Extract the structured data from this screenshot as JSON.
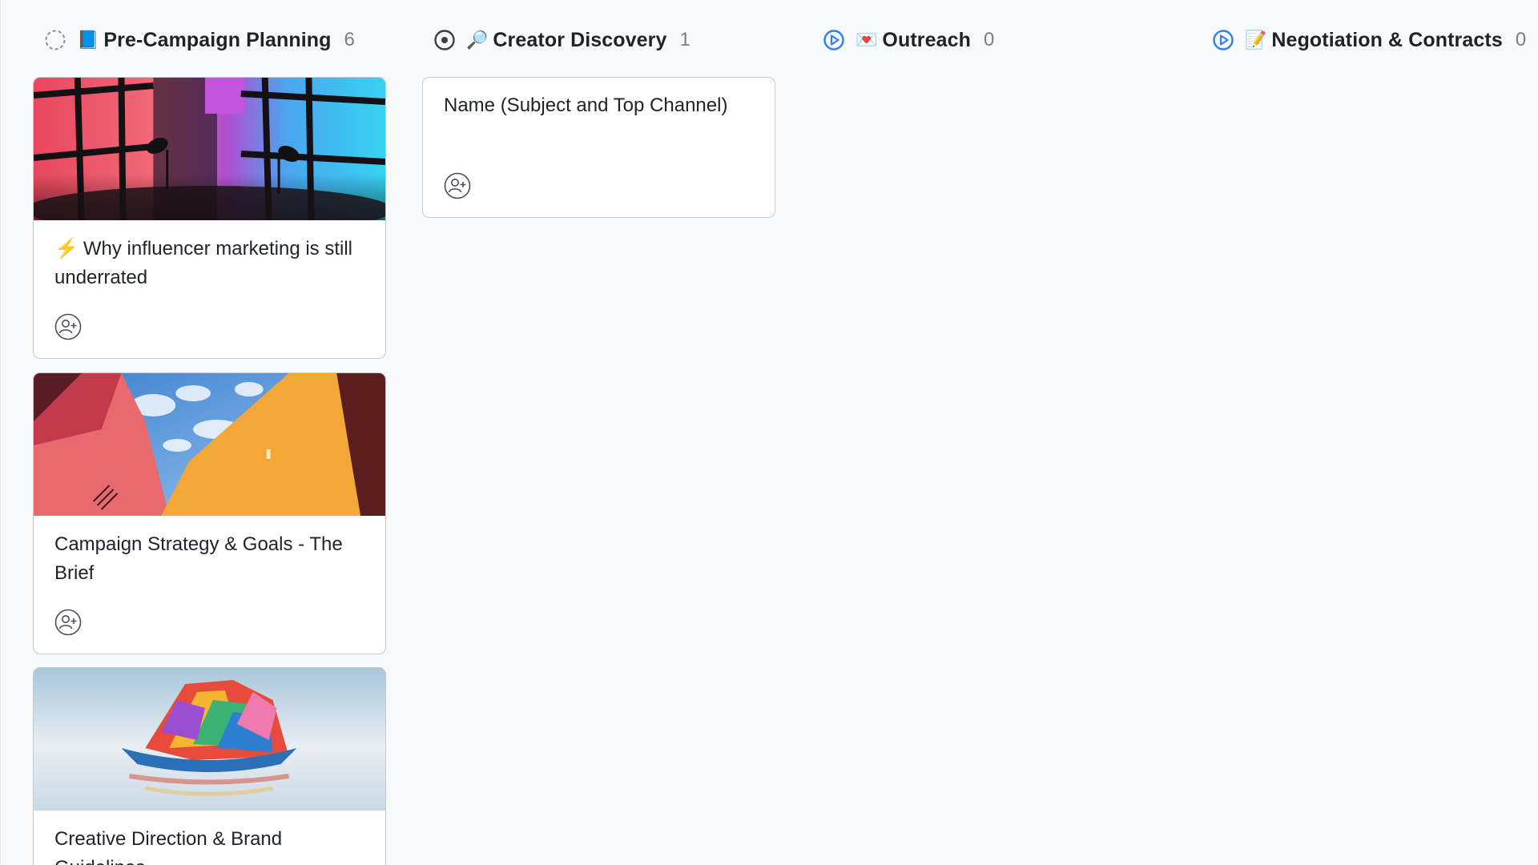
{
  "columns": [
    {
      "emoji": "📘",
      "title": "Pre-Campaign Planning",
      "count": "6",
      "status_icon": "dashed-circle-icon"
    },
    {
      "emoji": "🔎",
      "title": "Creator Discovery",
      "count": "1",
      "status_icon": "target-circle-icon"
    },
    {
      "emoji": "💌",
      "title": "Outreach",
      "count": "0",
      "status_icon": "play-circle-icon"
    },
    {
      "emoji": "📝",
      "title": "Negotiation & Contracts",
      "count": "0",
      "status_icon": "play-circle-icon"
    }
  ],
  "cards": {
    "c1": {
      "prefix": "⚡",
      "title": "Why influencer marketing is still underrated",
      "cover": "podcast-studio-image"
    },
    "c2": {
      "title": "Campaign Strategy & Goals - The Brief",
      "cover": "colorful-buildings-image"
    },
    "c3": {
      "title": "Creative Direction & Brand Guidelines",
      "cover": "rainbow-boat-image"
    },
    "c4": {
      "title": "Name (Subject and Top Channel)"
    }
  },
  "colors": {
    "accent_blue": "#2f80ed",
    "border": "#c6cad0",
    "count_gray": "#7a7f87"
  }
}
